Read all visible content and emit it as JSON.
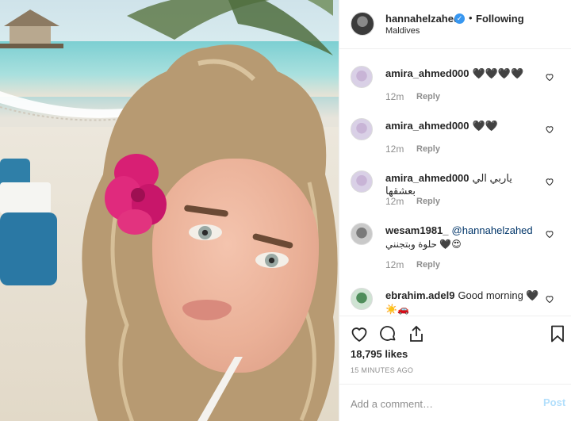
{
  "header": {
    "username": "hannahelzahed",
    "verified_badge": "✓",
    "separator": "•",
    "follow_status": "Following",
    "location": "Maldives"
  },
  "comments": [
    {
      "username": "amira_ahmed000",
      "text": "🖤🖤🖤🖤",
      "time": "12m",
      "reply": "Reply"
    },
    {
      "username": "amira_ahmed000",
      "text": "🖤🖤",
      "time": "12m",
      "reply": "Reply"
    },
    {
      "username": "amira_ahmed000",
      "text": "ياربي الي بعشقها",
      "time": "12m",
      "reply": "Reply"
    },
    {
      "username": "wesam1981_",
      "mention": "@hannahelzahed",
      "second_line": "حلوة وبتجنني 🖤😍",
      "time": "12m",
      "reply": "Reply"
    },
    {
      "username": "ebrahim.adel9",
      "text": "Good morning 🖤",
      "second_line": "☀️🚗"
    }
  ],
  "actions": {
    "like_icon": "heart-outline-icon",
    "comment_icon": "speech-bubble-icon",
    "share_icon": "share-icon",
    "save_icon": "bookmark-icon"
  },
  "likes": "18,795 likes",
  "time_ago": "15 MINUTES AGO",
  "comment_box": {
    "placeholder": "Add a comment…",
    "post_label": "Post"
  },
  "colors": {
    "verified": "#3897f0",
    "post_disabled": "#b2dffc",
    "muted": "#8e8e8e",
    "text": "#262626"
  }
}
